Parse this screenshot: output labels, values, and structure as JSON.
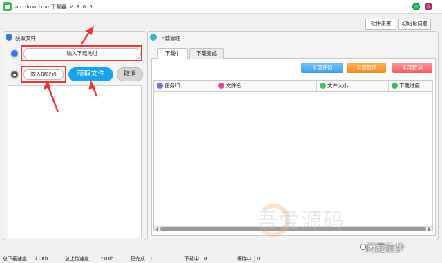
{
  "titlebar": {
    "title": "antdownload下载器  V.3.0.6"
  },
  "toolbar": {
    "settings_label": "软件设置",
    "init_label": "初始化问题"
  },
  "fetch_panel": {
    "title": "获取文件",
    "url_placeholder": "输入下载地址",
    "code_placeholder": "输入提取码",
    "fetch_label": "获取文件",
    "cancel_label": "取消"
  },
  "download_panel": {
    "title": "下载管理",
    "tabs": [
      {
        "label": "下载中",
        "active": true
      },
      {
        "label": "下载完成",
        "active": false
      }
    ],
    "actions": {
      "start_all": "全部开始",
      "pause_all": "全部暂停",
      "cancel_all": "全部取消"
    },
    "columns": [
      {
        "label": "任务ID",
        "icon": "task-id-icon",
        "color": "#8a63d2"
      },
      {
        "label": "文件名",
        "icon": "file-name-icon",
        "color": "#d84ea6"
      },
      {
        "label": "文件大小",
        "icon": "file-size-icon",
        "color": "#4cbf6a"
      },
      {
        "label": "下载进度",
        "icon": "progress-icon",
        "color": "#3dbb5a"
      }
    ],
    "rows": []
  },
  "status": {
    "total_down_label": "总下载速度",
    "down_speed": "↓0Kb",
    "total_up_label": "总上传速度",
    "up_speed": "↑0Kb",
    "completed_label": "已完成",
    "completed_value": "0",
    "downloading_label": "下载中",
    "downloading_value": "0",
    "waiting_label": "等待中",
    "waiting_value": "0"
  },
  "overlay": {
    "watermark": "吾爱源码",
    "credit": "闲庭信步"
  },
  "colors": {
    "highlight": "#e53935",
    "fetch_button": "#1aa3e8",
    "start_all": "#3d9fe8",
    "pause_all": "#f28a22",
    "cancel_all": "#ee5b5b"
  }
}
